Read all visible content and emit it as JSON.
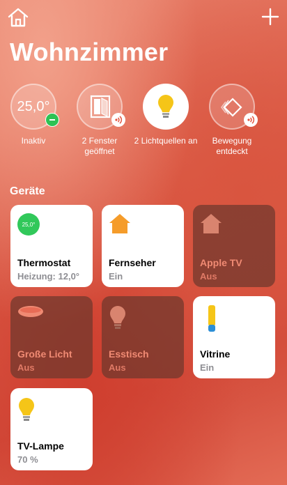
{
  "header": {
    "title": "Wohnzimmer"
  },
  "status": [
    {
      "label": "Inaktiv",
      "value": "25,0°"
    },
    {
      "label": "2 Fenster geöffnet"
    },
    {
      "label": "2 Lichtquellen an"
    },
    {
      "label": "Bewegung entdeckt"
    }
  ],
  "section": {
    "title": "Geräte"
  },
  "tiles": [
    {
      "name": "Thermostat",
      "state": "Heizung: 12,0°",
      "icon_text": "25,0°"
    },
    {
      "name": "Fernseher",
      "state": "Ein"
    },
    {
      "name": "Apple TV",
      "state": "Aus"
    },
    {
      "name": "Große Licht",
      "state": "Aus"
    },
    {
      "name": "Esstisch",
      "state": "Aus"
    },
    {
      "name": "Vitrine",
      "state": "Ein"
    },
    {
      "name": "TV-Lampe",
      "state": "70 %"
    }
  ],
  "colors": {
    "accent_green": "#31c85a",
    "home_orange": "#f59c2a",
    "bulb_yellow": "#f5c518",
    "tile_off": "#6e372d",
    "text_red": "#e5533e"
  },
  "icons": [
    "home-icon",
    "plus-icon",
    "window-icon",
    "lightbulb-icon",
    "motion-sensor-icon",
    "house-icon",
    "ceiling-lamp-icon",
    "light-strip-icon"
  ]
}
